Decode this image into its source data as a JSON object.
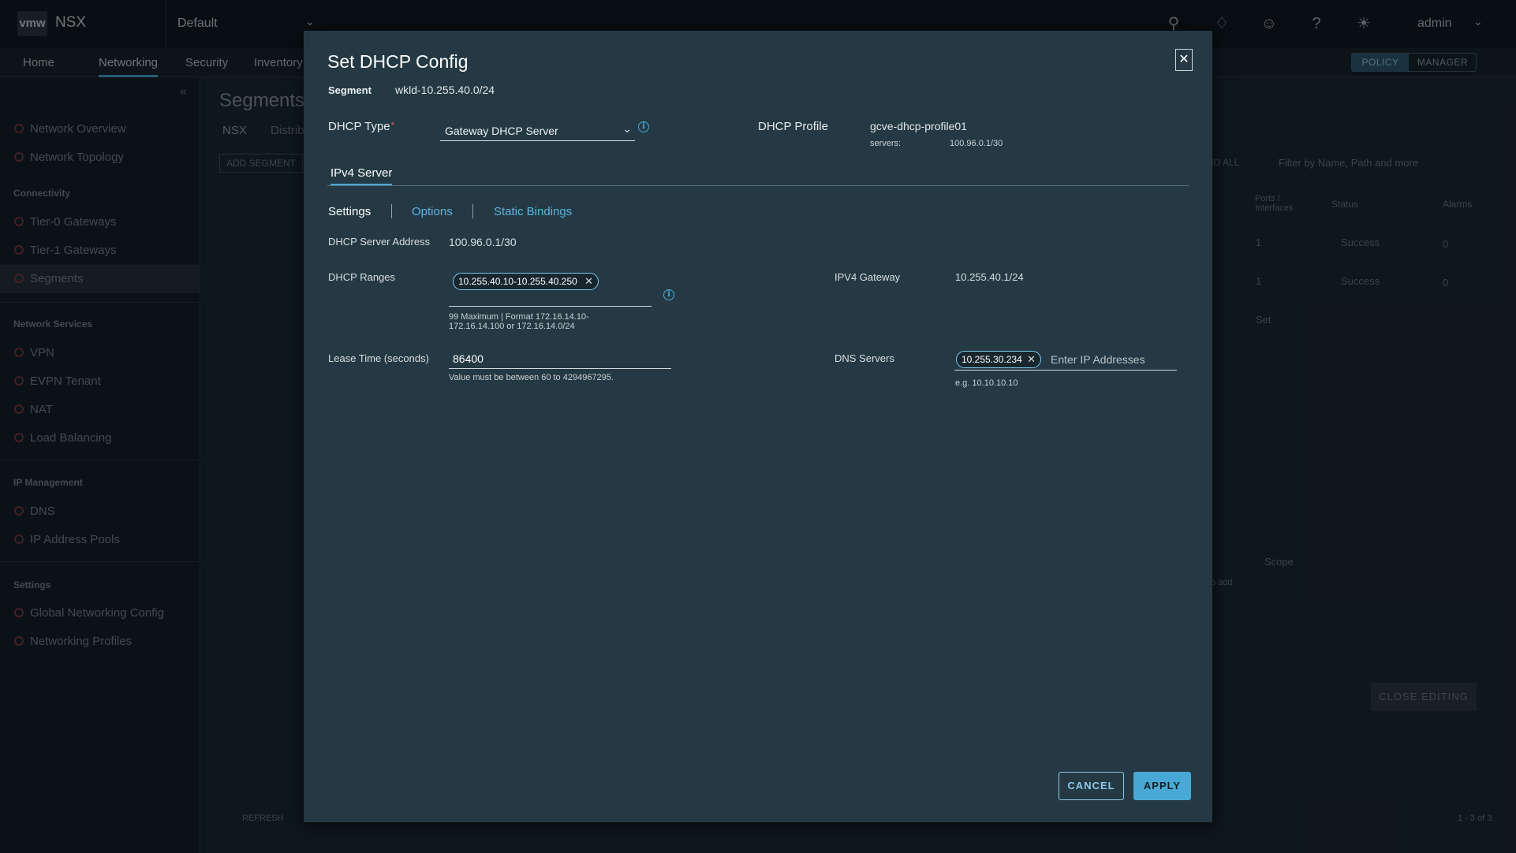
{
  "app": {
    "logo": "vmw",
    "name": "NSX",
    "scope": "Default",
    "user": "admin"
  },
  "nav": {
    "items": [
      "Home",
      "Networking",
      "Security",
      "Inventory"
    ],
    "mode_policy": "POLICY",
    "mode_manager": "MANAGER"
  },
  "sidebar": {
    "items": [
      {
        "label": "Network Overview"
      },
      {
        "label": "Network Topology"
      },
      {
        "label": "Tier-0 Gateways"
      },
      {
        "label": "Tier-1 Gateways"
      },
      {
        "label": "Segments"
      },
      {
        "label": "VPN"
      },
      {
        "label": "EVPN Tenant"
      },
      {
        "label": "NAT"
      },
      {
        "label": "Load Balancing"
      },
      {
        "label": "DNS"
      },
      {
        "label": "IP Address Pools"
      },
      {
        "label": "Global Networking Config"
      },
      {
        "label": "Networking Profiles"
      }
    ],
    "headers": [
      "Connectivity",
      "Network Services",
      "IP Management",
      "Settings"
    ]
  },
  "background": {
    "title": "Segments",
    "tab_nsx": "NSX",
    "tab_distributed": "Distrib",
    "add_segment": "ADD SEGMENT",
    "expand_all": "ND ALL",
    "filter_placeholder": "Filter by Name, Path and more",
    "col_ports": "Ports / Interfaces",
    "col_status": "Status",
    "col_alarms": "Alarms",
    "row_ports": "1",
    "row_status": "Success",
    "row_alarms": "0",
    "set_link": "Set",
    "scope": "Scope",
    "to_add": "o add",
    "close_editing": "CLOSE EDITING",
    "refresh": "REFRESH",
    "pagination": "1 - 3 of 3"
  },
  "modal": {
    "title": "Set DHCP Config",
    "segment_label": "Segment",
    "segment_value": "wkld-10.255.40.0/24",
    "dhcp_type_label": "DHCP Type",
    "required_mark": "*",
    "dhcp_type_value": "Gateway DHCP Server",
    "dhcp_profile_label": "DHCP Profile",
    "dhcp_profile_value": "gcve-dhcp-profile01",
    "servers_label": "servers:",
    "servers_value": "100.96.0.1/30",
    "tab_ipv4": "IPv4 Server",
    "subtabs": {
      "settings": "Settings",
      "options": "Options",
      "static_bindings": "Static Bindings"
    },
    "server_address_label": "DHCP Server Address",
    "server_address_value": "100.96.0.1/30",
    "ranges_label": "DHCP Ranges",
    "range_chip": "10.255.40.10-10.255.40.250",
    "ranges_help_1": "99 Maximum | Format 172.16.14.10-",
    "ranges_help_2": "172.16.14.100 or 172.16.14.0/24",
    "gateway_label": "IPV4 Gateway",
    "gateway_value": "10.255.40.1/24",
    "lease_label": "Lease Time (seconds)",
    "lease_value": "86400",
    "lease_help": "Value must be between 60 to 4294967295.",
    "dns_label": "DNS Servers",
    "dns_chip": "10.255.30.234",
    "dns_placeholder": "Enter IP Addresses",
    "dns_help": "e.g. 10.10.10.10",
    "cancel": "CANCEL",
    "apply": "APPLY"
  },
  "colors": {
    "accent": "#49a9d6",
    "modal_bg": "#243943",
    "required": "#e05a5a",
    "success": "#5fbf4a"
  }
}
